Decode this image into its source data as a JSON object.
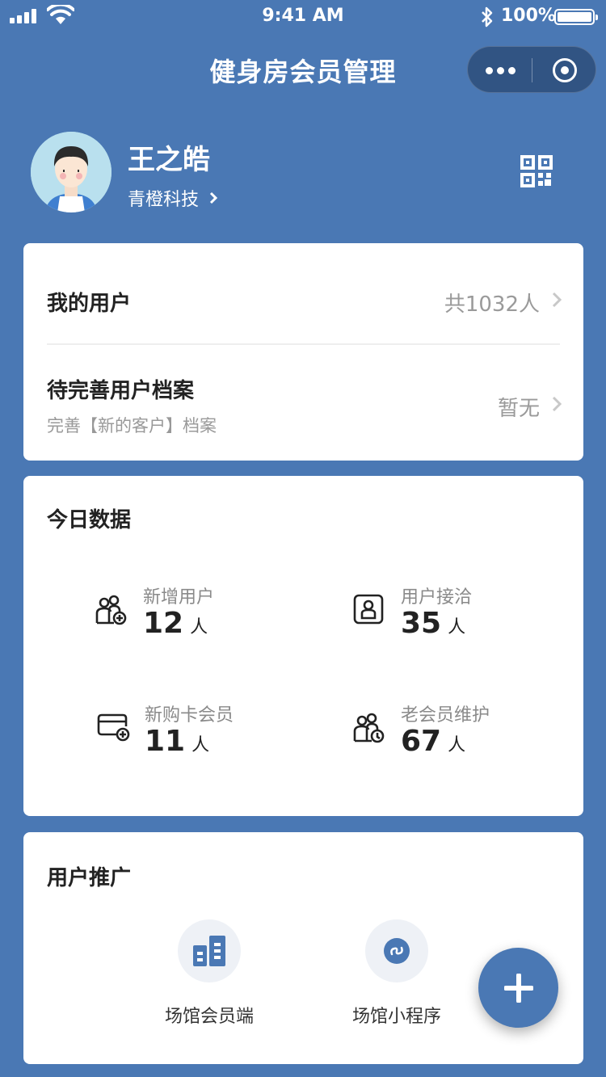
{
  "status": {
    "time": "9:41 AM",
    "battery": "100%"
  },
  "nav": {
    "title": "健身房会员管理"
  },
  "profile": {
    "name": "王之皓",
    "company": "青橙科技"
  },
  "users": {
    "my_users_label": "我的用户",
    "my_users_count": "共1032人",
    "pending_label": "待完善用户档案",
    "pending_sub": "完善【新的客户】档案",
    "pending_value": "暂无"
  },
  "today": {
    "title": "今日数据",
    "unit": "人",
    "stats": [
      {
        "label": "新增用户",
        "value": "12",
        "icon": "user-add-icon"
      },
      {
        "label": "用户接洽",
        "value": "35",
        "icon": "contact-card-icon"
      },
      {
        "label": "新购卡会员",
        "value": "11",
        "icon": "card-add-icon"
      },
      {
        "label": "老会员维护",
        "value": "67",
        "icon": "user-maintain-icon"
      }
    ]
  },
  "promotion": {
    "title": "用户推广",
    "items": [
      {
        "label": "场馆会员端",
        "icon": "building-icon"
      },
      {
        "label": "场馆小程序",
        "icon": "mini-program-icon"
      }
    ]
  },
  "colors": {
    "brand": "#4a78b4",
    "card": "#ffffff",
    "muted": "#9a9a9a"
  }
}
